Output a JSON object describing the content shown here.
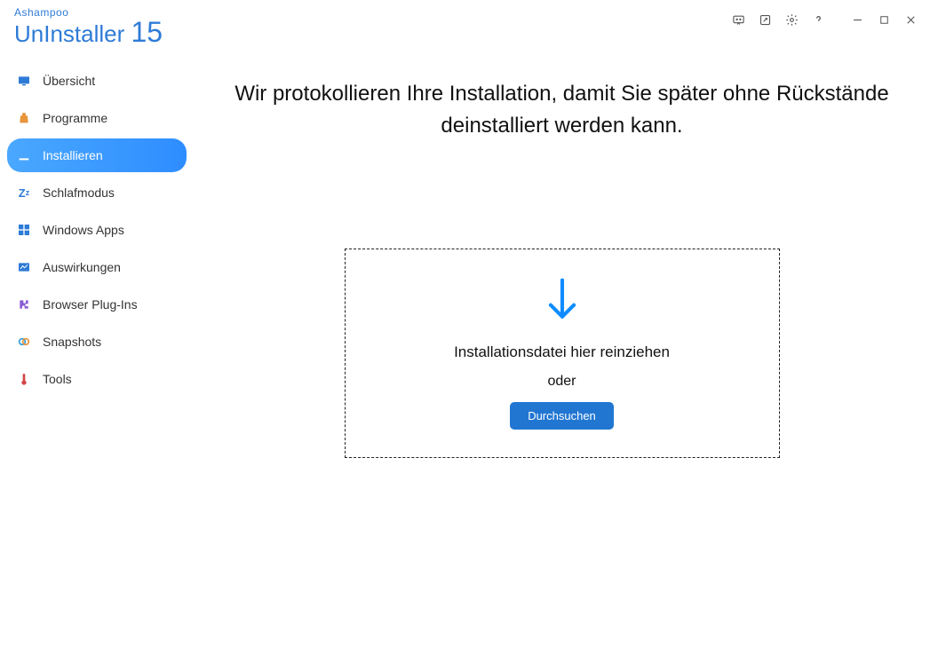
{
  "brand": {
    "top": "Ashampoo",
    "name": "UnInstaller ",
    "version": "15"
  },
  "sidebar": {
    "items": [
      {
        "label": "Übersicht"
      },
      {
        "label": "Programme"
      },
      {
        "label": "Installieren"
      },
      {
        "label": "Schlafmodus"
      },
      {
        "label": "Windows Apps"
      },
      {
        "label": "Auswirkungen"
      },
      {
        "label": "Browser Plug-Ins"
      },
      {
        "label": "Snapshots"
      },
      {
        "label": "Tools"
      }
    ]
  },
  "main": {
    "heading": "Wir protokollieren Ihre Installation, damit Sie später ohne Rückstände deinstalliert werden kann.",
    "drop_text1": "Installationsdatei hier reinziehen",
    "drop_text2": "oder",
    "browse_label": "Durchsuchen"
  }
}
